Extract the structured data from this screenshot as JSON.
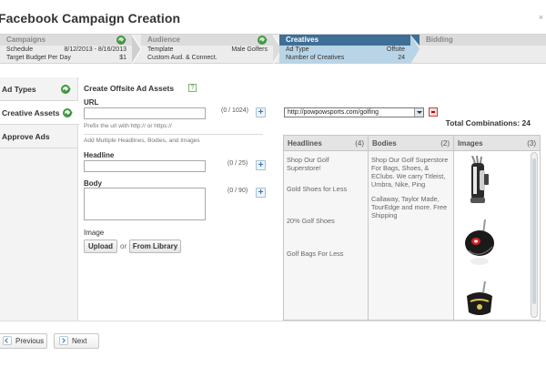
{
  "page": {
    "title": "Facebook Campaign Creation",
    "close": "×"
  },
  "steps": {
    "campaigns": {
      "label": "Campaigns",
      "rows": [
        [
          "Schedule",
          "8/12/2013 - 8/16/2013"
        ],
        [
          "Target Budget Per Day",
          "$1"
        ]
      ]
    },
    "audience": {
      "label": "Audience",
      "rows": [
        [
          "Template",
          "Male Golfers"
        ],
        [
          "Custom Aud. & Connect.",
          ""
        ]
      ]
    },
    "creatives": {
      "label": "Creatives",
      "rows": [
        [
          "Ad Type",
          "Offsite"
        ],
        [
          "Number of Creatives",
          "24"
        ]
      ]
    },
    "bidding": {
      "label": "Bidding"
    }
  },
  "sidebar": {
    "items": [
      {
        "label": "Ad Types",
        "done": true
      },
      {
        "label": "Creative Assets",
        "done": true
      },
      {
        "label": "Approve Ads",
        "done": false
      }
    ]
  },
  "form": {
    "title": "Create Offsite Ad Assets",
    "help": "?",
    "url": {
      "label": "URL",
      "counter": "(0 / 1024)",
      "hint": "Prefix the url with http:// or https://"
    },
    "multi_hint": "Add Multiple Headlines, Bodies, and Images",
    "headline": {
      "label": "Headline",
      "counter": "(0 / 25)"
    },
    "body": {
      "label": "Body",
      "counter": "(0 / 90)"
    },
    "image": {
      "label": "Image",
      "upload": "Upload",
      "or": "or",
      "library": "From Library"
    }
  },
  "assets": {
    "url_value": "http://powpowsports.com/golfing",
    "total": "Total Combinations: 24",
    "headlines": {
      "label": "Headlines",
      "count": "(4)",
      "items": [
        "Shop Our Golf Superstore!",
        "Gold Shoes for Less",
        "20% Golf Shoes",
        "Golf Bags For Less"
      ]
    },
    "bodies": {
      "label": "Bodies",
      "count": "(2)",
      "items": [
        "Shop Our Golf Superstore For Bags, Shoes, & EClubs. We carry Titleist, Umbra, Nike, Ping",
        "Callaway, Taylor Made, TourEdge and more. Free Shipping"
      ]
    },
    "images": {
      "label": "Images",
      "count": "(3)",
      "items": [
        "golf-bag-image",
        "driver-club-image",
        "golf-club-head-image"
      ]
    }
  },
  "footer": {
    "previous": "Previous",
    "next": "Next"
  },
  "colors": {
    "accent": "#3e6f96",
    "active_bg": "#b9d4e6",
    "check": "#3a9a3a"
  }
}
